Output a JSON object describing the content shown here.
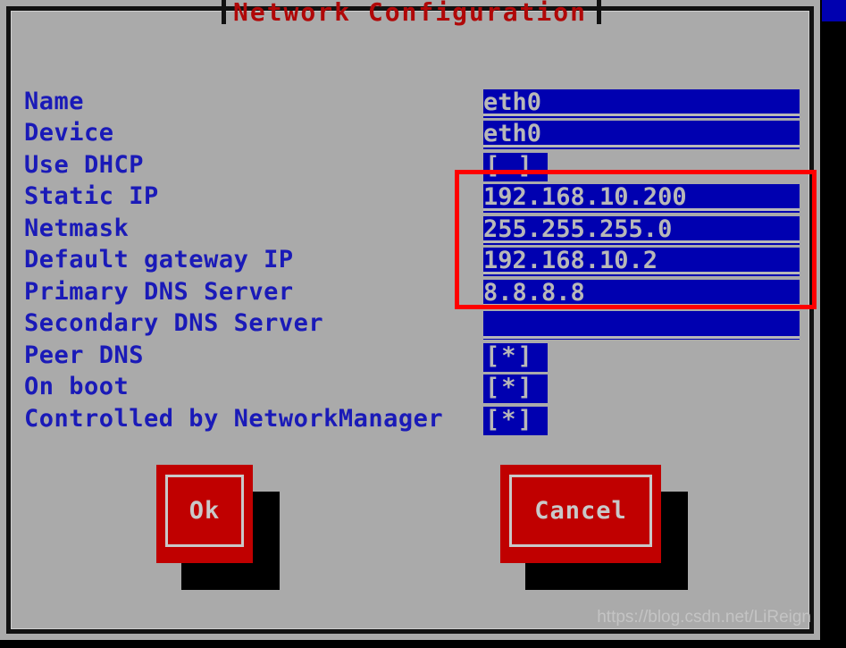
{
  "window": {
    "title": "Network Configuration",
    "background_color": "#aaaaaa",
    "frame_color": "#111111",
    "title_color": "#b00808"
  },
  "form": {
    "field_bg_color": "#0000b0",
    "field_text_color": "#b8b8b8",
    "label_color": "#1a1ab8",
    "rows": [
      {
        "label": "Name",
        "value": "eth0",
        "type": "text"
      },
      {
        "label": "Device",
        "value": "eth0",
        "type": "text"
      },
      {
        "label": "Use DHCP",
        "value": "[ ]",
        "type": "checkbox",
        "checked": false
      },
      {
        "label": "Static IP",
        "value": "192.168.10.200",
        "type": "text"
      },
      {
        "label": "Netmask",
        "value": "255.255.255.0",
        "type": "text"
      },
      {
        "label": "Default gateway IP",
        "value": "192.168.10.2",
        "type": "text"
      },
      {
        "label": "Primary DNS Server",
        "value": "8.8.8.8",
        "type": "text"
      },
      {
        "label": "Secondary DNS Server",
        "value": "",
        "type": "text"
      },
      {
        "label": "Peer DNS",
        "value": "[*]",
        "type": "checkbox",
        "checked": true
      },
      {
        "label": "On boot",
        "value": "[*]",
        "type": "checkbox",
        "checked": true
      },
      {
        "label": "Controlled by NetworkManager",
        "value": "[*]",
        "type": "checkbox",
        "checked": true
      }
    ]
  },
  "buttons": {
    "ok_label": "Ok",
    "cancel_label": "Cancel",
    "button_color": "#c00000",
    "button_text_color": "#c9c9c9"
  },
  "annotation": {
    "color": "#ff0000",
    "highlights": [
      "Static IP",
      "Netmask",
      "Default gateway IP",
      "Primary DNS Server"
    ]
  },
  "watermark": {
    "text": "https://blog.csdn.net/LiReign"
  }
}
